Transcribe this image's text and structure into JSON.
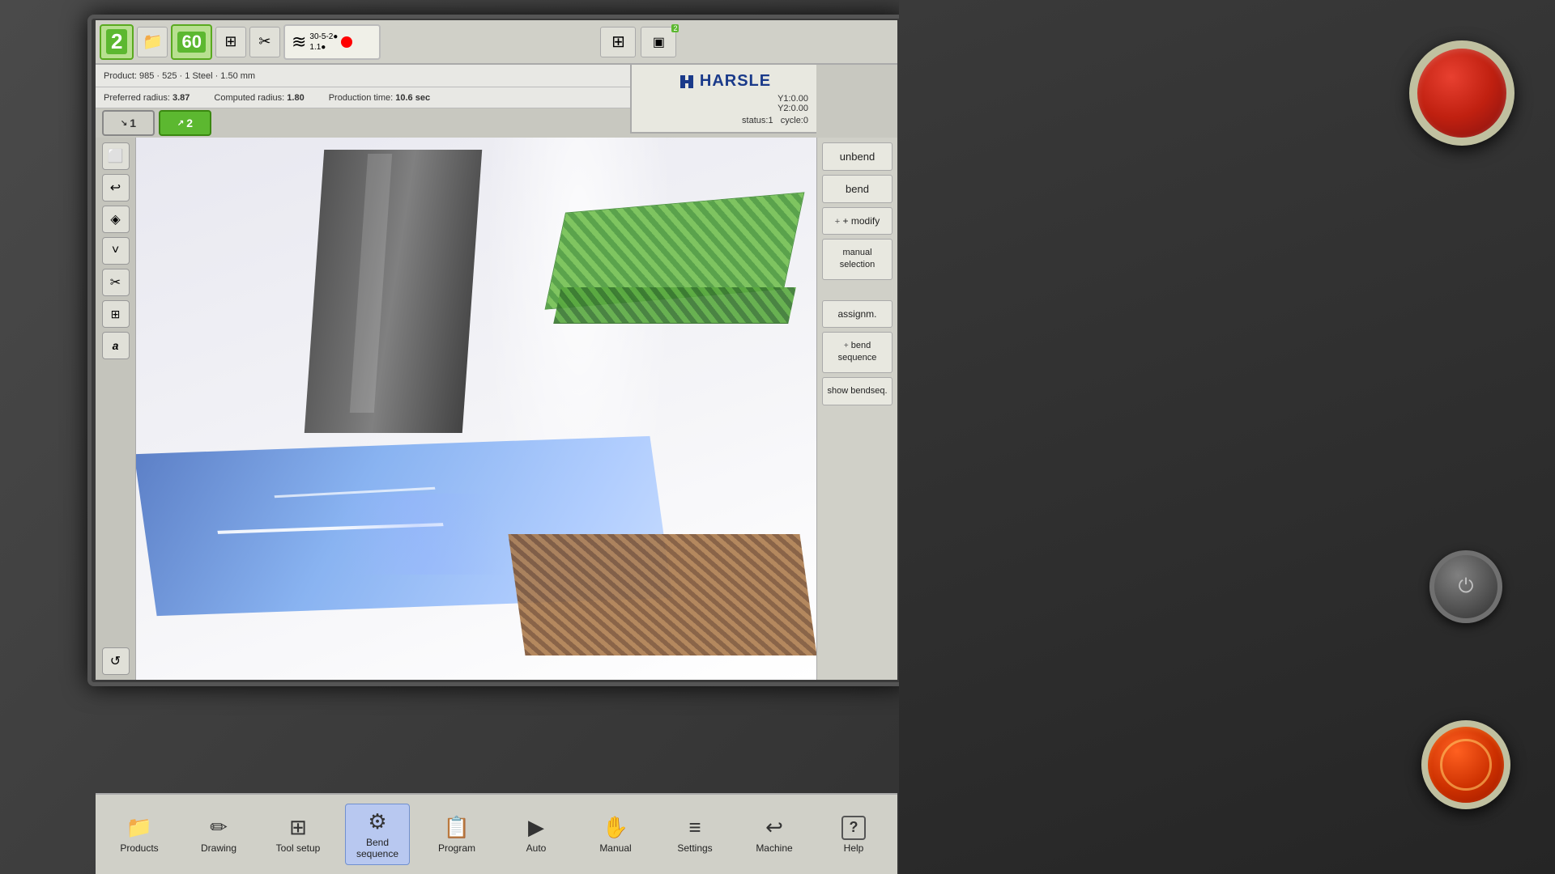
{
  "app": {
    "title": "HARSLE Bend Sequence",
    "brand": "HARSLE"
  },
  "header": {
    "step_num": "2",
    "speed_val": "60",
    "product_info": "Product: 985 · 525 · 1 Steel · 1.50 mm",
    "preferred_radius_label": "Preferred radius:",
    "preferred_radius_val": "3.87",
    "computed_radius_label": "Computed radius:",
    "computed_radius_val": "1.80",
    "production_time_label": "Production time:",
    "production_time_val": "10.6 sec",
    "y1": "Y1:0.00",
    "y2": "Y2:0.00",
    "status": "status:1",
    "cycle": "cycle:0"
  },
  "bend_steps": [
    {
      "num": "1",
      "active": false
    },
    {
      "num": "2",
      "active": true
    }
  ],
  "sidebar_buttons": [
    {
      "icon": "⬜",
      "name": "frame-icon"
    },
    {
      "icon": "↩",
      "name": "undo-icon"
    },
    {
      "icon": "◈",
      "name": "layers-icon"
    },
    {
      "icon": "˅",
      "name": "down-icon"
    },
    {
      "icon": "✂",
      "name": "cut-icon"
    },
    {
      "icon": "⊞",
      "name": "grid-icon"
    },
    {
      "icon": "ⓐ",
      "name": "text-icon"
    },
    {
      "icon": "↺",
      "name": "rotate-icon"
    }
  ],
  "right_panel": {
    "buttons": [
      {
        "label": "unbend",
        "name": "unbend-button",
        "active": false
      },
      {
        "label": "bend",
        "name": "bend-button",
        "active": false
      },
      {
        "label": "+ modify",
        "name": "modify-button",
        "active": false
      },
      {
        "label": "manual selection",
        "name": "manual-selection-button",
        "active": false
      },
      {
        "label": "assignm.",
        "name": "assignment-button",
        "active": false
      },
      {
        "label": "+ bend sequence",
        "name": "bend-sequence-button",
        "active": false
      },
      {
        "label": "show bendseq.",
        "name": "show-bendseq-button",
        "active": false
      }
    ]
  },
  "bottom_nav": {
    "items": [
      {
        "label": "Products",
        "icon": "📁",
        "name": "nav-products",
        "active": false
      },
      {
        "label": "Drawing",
        "icon": "✏",
        "name": "nav-drawing",
        "active": false
      },
      {
        "label": "Tool setup",
        "icon": "⊞",
        "name": "nav-tool-setup",
        "active": false
      },
      {
        "label": "Bend\nsequence",
        "icon": "⚙",
        "name": "nav-bend-sequence",
        "active": true
      },
      {
        "label": "Program",
        "icon": "📋",
        "name": "nav-program",
        "active": false
      },
      {
        "label": "Auto",
        "icon": "▶",
        "name": "nav-auto",
        "active": false
      },
      {
        "label": "Manual",
        "icon": "✋",
        "name": "nav-manual",
        "active": false
      },
      {
        "label": "Settings",
        "icon": "≡",
        "name": "nav-settings",
        "active": false
      },
      {
        "label": "Machine",
        "icon": "↩",
        "name": "nav-machine",
        "active": false
      },
      {
        "label": "Help",
        "icon": "?",
        "name": "nav-help",
        "active": false
      }
    ]
  }
}
